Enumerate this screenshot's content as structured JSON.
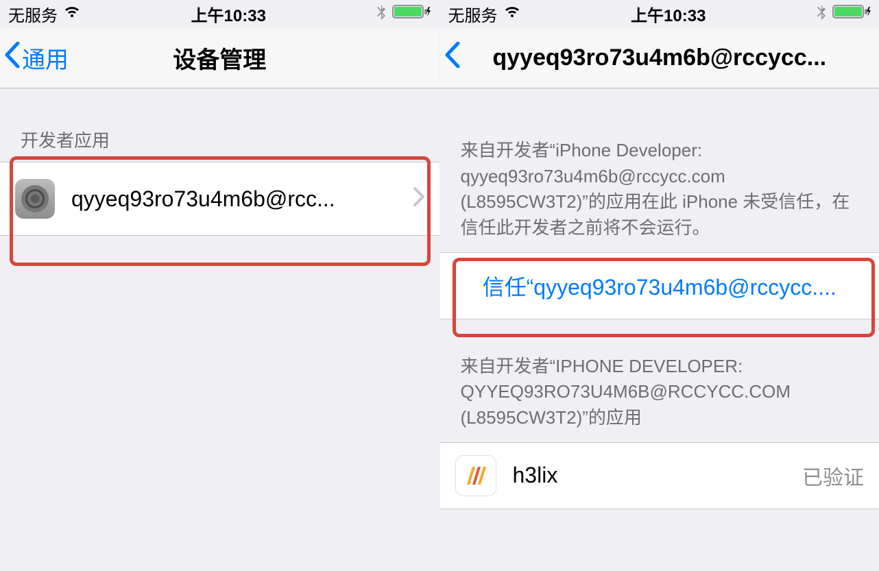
{
  "status": {
    "carrier": "无服务",
    "time": "上午10:33"
  },
  "left": {
    "nav_back": "通用",
    "nav_title": "设备管理",
    "section_header": "开发者应用",
    "profile_name": "qyyeq93ro73u4m6b@rcc..."
  },
  "right": {
    "nav_title": "qyyeq93ro73u4m6b@rccycc...",
    "note1": "来自开发者“iPhone Developer: qyyeq93ro73u4m6b@rccycc.com (L8595CW3T2)”的应用在此 iPhone 未受信任，在信任此开发者之前将不会运行。",
    "trust_label": "信任“qyyeq93ro73u4m6b@rccycc....",
    "note2": "来自开发者“IPHONE DEVELOPER: QYYEQ93RO73U4M6B@RCCYCC.COM (L8595CW3T2)”的应用",
    "app_name": "h3lix",
    "app_status": "已验证"
  }
}
